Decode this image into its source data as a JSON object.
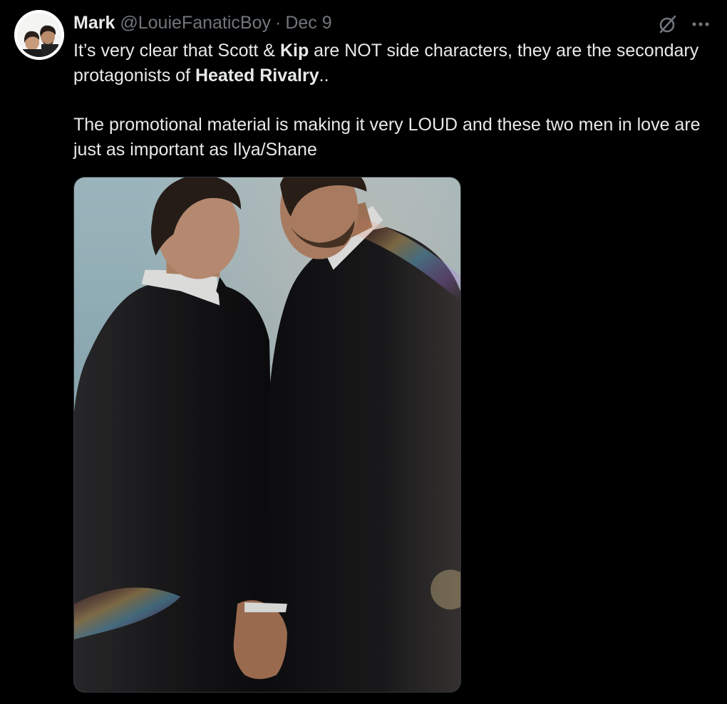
{
  "tweet": {
    "author": {
      "display_name": "Mark",
      "handle": "@LouieFanaticBoy",
      "separator": "·",
      "date": "Dec 9"
    },
    "text": {
      "p1_a": "It’s very clear that Scott & ",
      "p1_b": "Kip",
      "p1_c": " are NOT side characters, they are the secondary protagonists of ",
      "p1_d": "Heated Rivalry",
      "p1_e": "..",
      "p2": "The promotional material is making it very LOUD and these two men in love are just as important as Ilya/Shane"
    },
    "icons": {
      "grok": "grok-icon",
      "more": "more-icon",
      "avatar": "avatar"
    },
    "media": {
      "alt": "Two men in black tuxedos facing each other against a pale blue sky, holding hands"
    },
    "colors": {
      "background": "#000000",
      "text_primary": "#e7e9ea",
      "text_secondary": "#71767b",
      "border": "#2f3336"
    }
  }
}
